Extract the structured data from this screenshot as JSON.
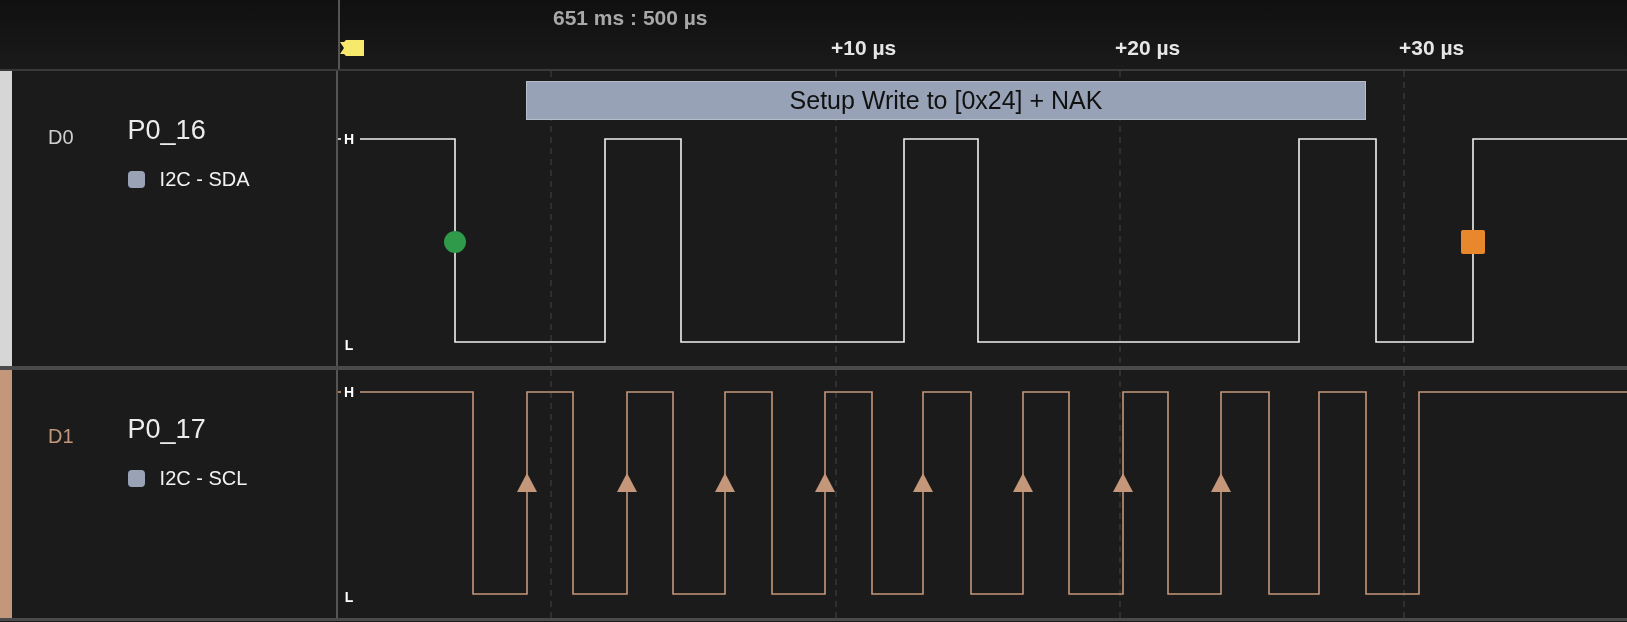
{
  "header": {
    "cursor_time": "651 ms : 500 µs",
    "ticks": [
      "+10 µs",
      "+20 µs",
      "+30 µs"
    ]
  },
  "channels": [
    {
      "id": "D0",
      "name": "P0_16",
      "analyzer": "I2C - SDA",
      "color": "#d6d6d6",
      "high_label": "H",
      "low_label": "L",
      "annotations": [
        "Setup Write to [0x24] + NAK"
      ]
    },
    {
      "id": "D1",
      "name": "P0_17",
      "analyzer": "I2C - SCL",
      "color": "#c4967a",
      "high_label": "H",
      "low_label": "L"
    }
  ]
}
